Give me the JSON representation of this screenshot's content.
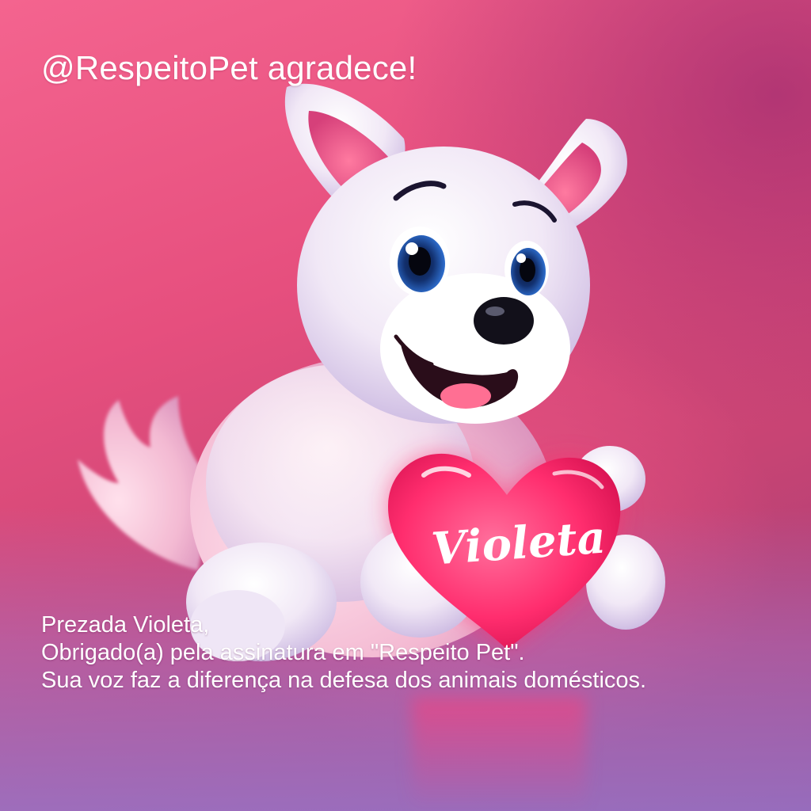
{
  "header": {
    "title": "@RespeitoPet agradece!"
  },
  "illustration": {
    "subject": "puppy-holding-heart",
    "heart_name": "Violeta",
    "heart_color": "#ff2d6e",
    "background_colors": [
      "#f4648f",
      "#c84474",
      "#9a3d78"
    ]
  },
  "message": {
    "greeting": "Prezada Violeta,",
    "line1": "Obrigado(a) pela assinatura em \"Respeito Pet\".",
    "line2": "Sua voz faz a diferença na defesa dos animais domésticos."
  }
}
